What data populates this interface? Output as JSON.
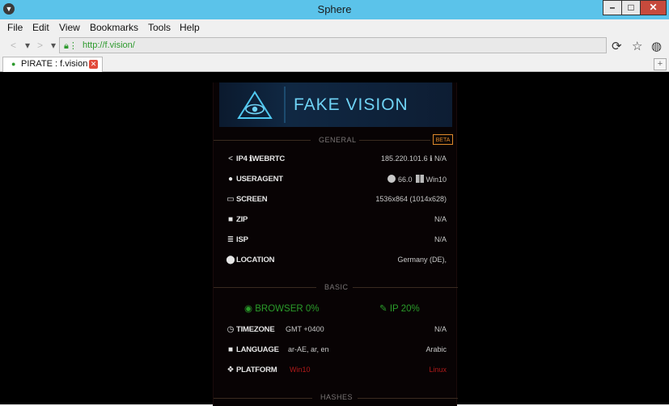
{
  "window": {
    "title": "Sphere"
  },
  "menu": [
    "File",
    "Edit",
    "View",
    "Bookmarks",
    "Tools",
    "Help"
  ],
  "address": {
    "url": "http://f.vision/"
  },
  "tabs": [
    {
      "label": "PIRATE : f.vision"
    }
  ],
  "banner": {
    "brand": "FAKE VISION"
  },
  "sections": {
    "general": "GENERAL",
    "beta": "BETA",
    "basic": "BASIC",
    "hashes": "HASHES"
  },
  "general_rows": [
    {
      "icon": "share-icon",
      "label": "IP4 ℹWEBRTC",
      "value": "185.220.101.6 ℹ N/A"
    },
    {
      "icon": "user-icon",
      "label": "USERAGENT",
      "value_browser": "66.0",
      "value_os": "Win10"
    },
    {
      "icon": "monitor-icon",
      "label": "SCREEN",
      "value": "1536x864 (1014x628)"
    },
    {
      "icon": "truck-icon",
      "label": "ZIP",
      "value": "N/A"
    },
    {
      "icon": "server-icon",
      "label": "ISP",
      "value": "N/A"
    },
    {
      "icon": "location-pin-icon",
      "label": "LOCATION",
      "value": "Germany (DE),"
    }
  ],
  "scores": {
    "browser": "BROWSER 0%",
    "ip": "IP 20%"
  },
  "basic_rows": [
    {
      "icon": "clock-icon",
      "label": "TIMEZONE",
      "mid": "GMT +0400",
      "value": "N/A"
    },
    {
      "icon": "truck-icon",
      "label": "LANGUAGE",
      "mid": "ar-AE, ar, en",
      "value": "Arabic"
    },
    {
      "icon": "cubes-icon",
      "label": "PLATFORM",
      "mid": "Win10",
      "value": "Linux"
    }
  ],
  "colors": {
    "titlebar": "#5bc3ea",
    "accent_green": "#2a9c2a",
    "mismatch_red": "#b11a1a",
    "beta_orange": "#e08a2c"
  }
}
